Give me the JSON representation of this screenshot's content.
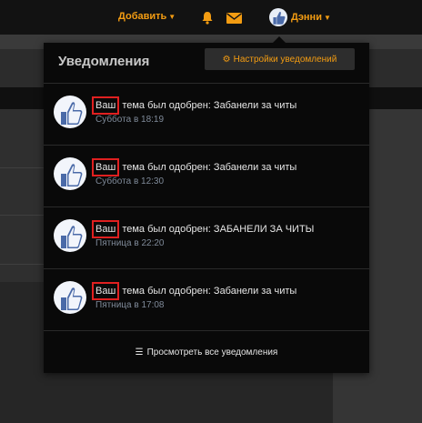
{
  "topnav": {
    "add_label": "Добавить",
    "username": "Дэнни"
  },
  "dropdown": {
    "title": "Уведомления",
    "settings_label": "Настройки уведомлений",
    "footer_label": "Просмотреть все уведомления",
    "notifications": [
      {
        "highlight": "Ваш",
        "text": " тема был одобрен: Забанели за читы",
        "time": "Суббота в 18:19"
      },
      {
        "highlight": "Ваш",
        "text": " тема был одобрен: Забанели за читы",
        "time": "Суббота в 12:30"
      },
      {
        "highlight": "Ваш",
        "text": " тема был одобрен: ЗАБАНЕЛИ ЗА ЧИТЫ",
        "time": "Пятница в 22:20"
      },
      {
        "highlight": "Ваш",
        "text": " тема был одобрен: Забанели за читы",
        "time": "Пятница в 17:08"
      }
    ]
  },
  "colors": {
    "accent": "#f39c12",
    "highlight_box": "#e02020",
    "dropdown_bg": "#090909"
  },
  "icons": [
    "bell-icon",
    "envelope-icon",
    "gear-icon",
    "list-icon",
    "thumbs-up-icon",
    "caret-down-icon"
  ]
}
